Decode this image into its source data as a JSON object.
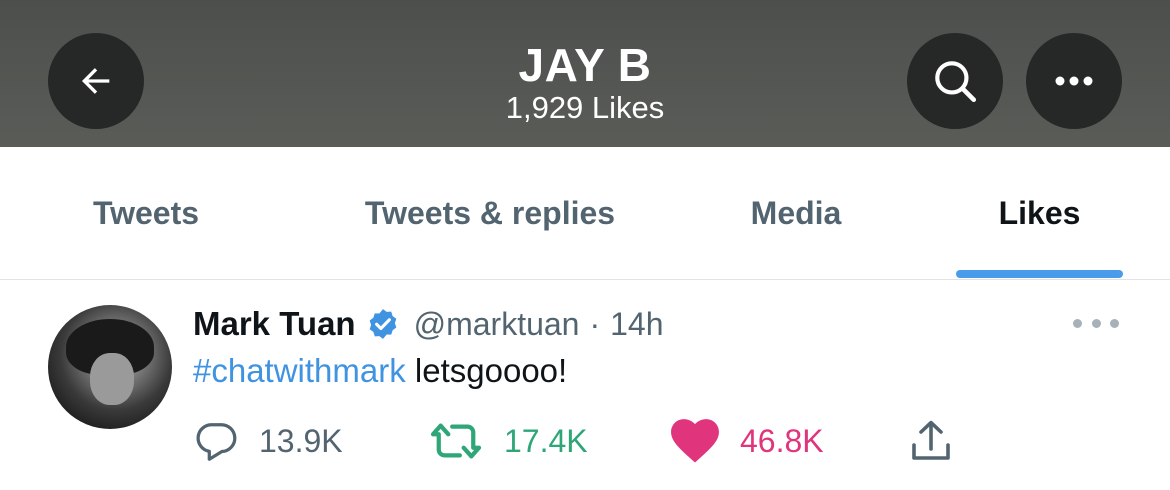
{
  "header": {
    "title": "JAY B",
    "subtitle": "1,929 Likes",
    "icons": {
      "back": "arrow-left-icon",
      "search": "search-icon",
      "more": "more-horizontal-icon"
    }
  },
  "tabs": [
    {
      "label": "Tweets",
      "active": false
    },
    {
      "label": "Tweets & replies",
      "active": false
    },
    {
      "label": "Media",
      "active": false
    },
    {
      "label": "Likes",
      "active": true
    }
  ],
  "tweet": {
    "name": "Mark Tuan",
    "verified": true,
    "handle": "@marktuan",
    "separator": "·",
    "time": "14h",
    "hashtag": "#chatwithmark",
    "text": " letsgoooo!",
    "actions": {
      "reply_count": "13.9K",
      "retweet_count": "17.4K",
      "like_count": "46.8K"
    }
  },
  "colors": {
    "accent": "#4a9bea",
    "hashtag": "#3f93e0",
    "retweet": "#2fa677",
    "like": "#e0357c",
    "muted": "#536471"
  }
}
